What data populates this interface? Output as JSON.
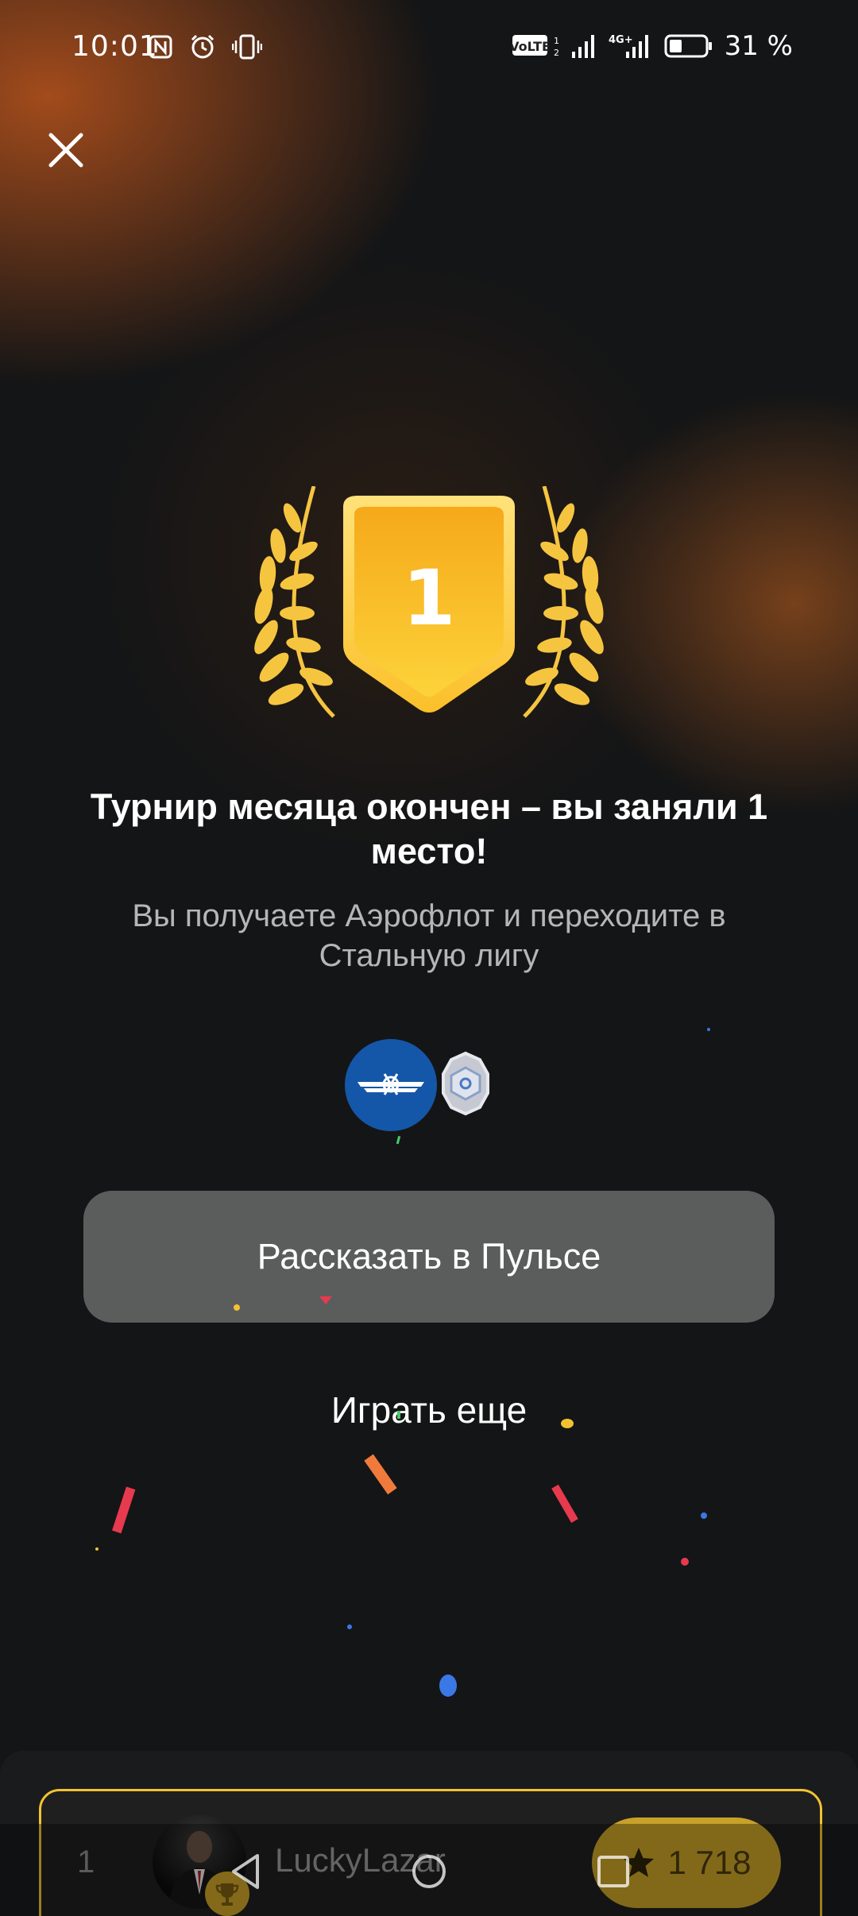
{
  "status_bar": {
    "time": "10:01",
    "battery_percent": "31 %",
    "icons_left": [
      "nfc-icon",
      "alarm-icon",
      "vibrate-icon"
    ],
    "icons_right": [
      "volte-icon",
      "signal-icon",
      "4g-icon",
      "signal-icon",
      "battery-icon"
    ],
    "battery_level": 0.31
  },
  "result": {
    "place_number": "1",
    "headline": "Турнир месяца окончен – вы заняли 1 место!",
    "subline": "Вы получаете Аэрофлот и переходите в Стальную лигу"
  },
  "actions": {
    "share_label": "Рассказать в Пульсе",
    "play_again_label": "Играть еще"
  },
  "leaderboard": {
    "rank": "1",
    "username": "LuckyLazar",
    "score": "1 718"
  },
  "colors": {
    "accent_gold": "#f2c230",
    "button_gray": "#5b5d5d",
    "aeroflot_blue": "#1457a8",
    "background": "#141516"
  }
}
